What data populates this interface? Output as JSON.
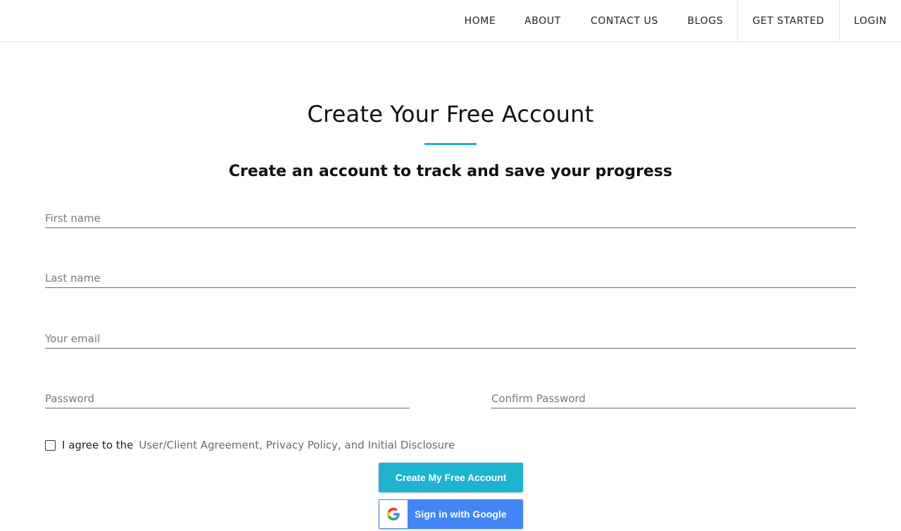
{
  "nav": {
    "items": [
      {
        "label": "HOME"
      },
      {
        "label": "ABOUT"
      },
      {
        "label": "CONTACT US"
      },
      {
        "label": "BLOGS"
      },
      {
        "label": "GET STARTED"
      },
      {
        "label": "LOGIN"
      }
    ]
  },
  "header": {
    "title": "Create Your Free Account",
    "subtitle": "Create an account to track and save your progress"
  },
  "form": {
    "first_name": {
      "placeholder": "First name",
      "value": ""
    },
    "last_name": {
      "placeholder": "Last name",
      "value": ""
    },
    "email": {
      "placeholder": "Your email",
      "value": ""
    },
    "password": {
      "placeholder": "Password",
      "value": ""
    },
    "confirm_password": {
      "placeholder": "Confirm Password",
      "value": ""
    },
    "agree": {
      "checked": false,
      "prefix": "I agree to the",
      "link": "User/Client Agreement, Privacy Policy, and Initial Disclosure"
    },
    "create_button": "Create My Free Account",
    "google_button": "Sign in with Google"
  },
  "colors": {
    "accent": "#21b2cf",
    "google_blue": "#4285f4"
  },
  "icons": {
    "google": "google-g-icon"
  }
}
